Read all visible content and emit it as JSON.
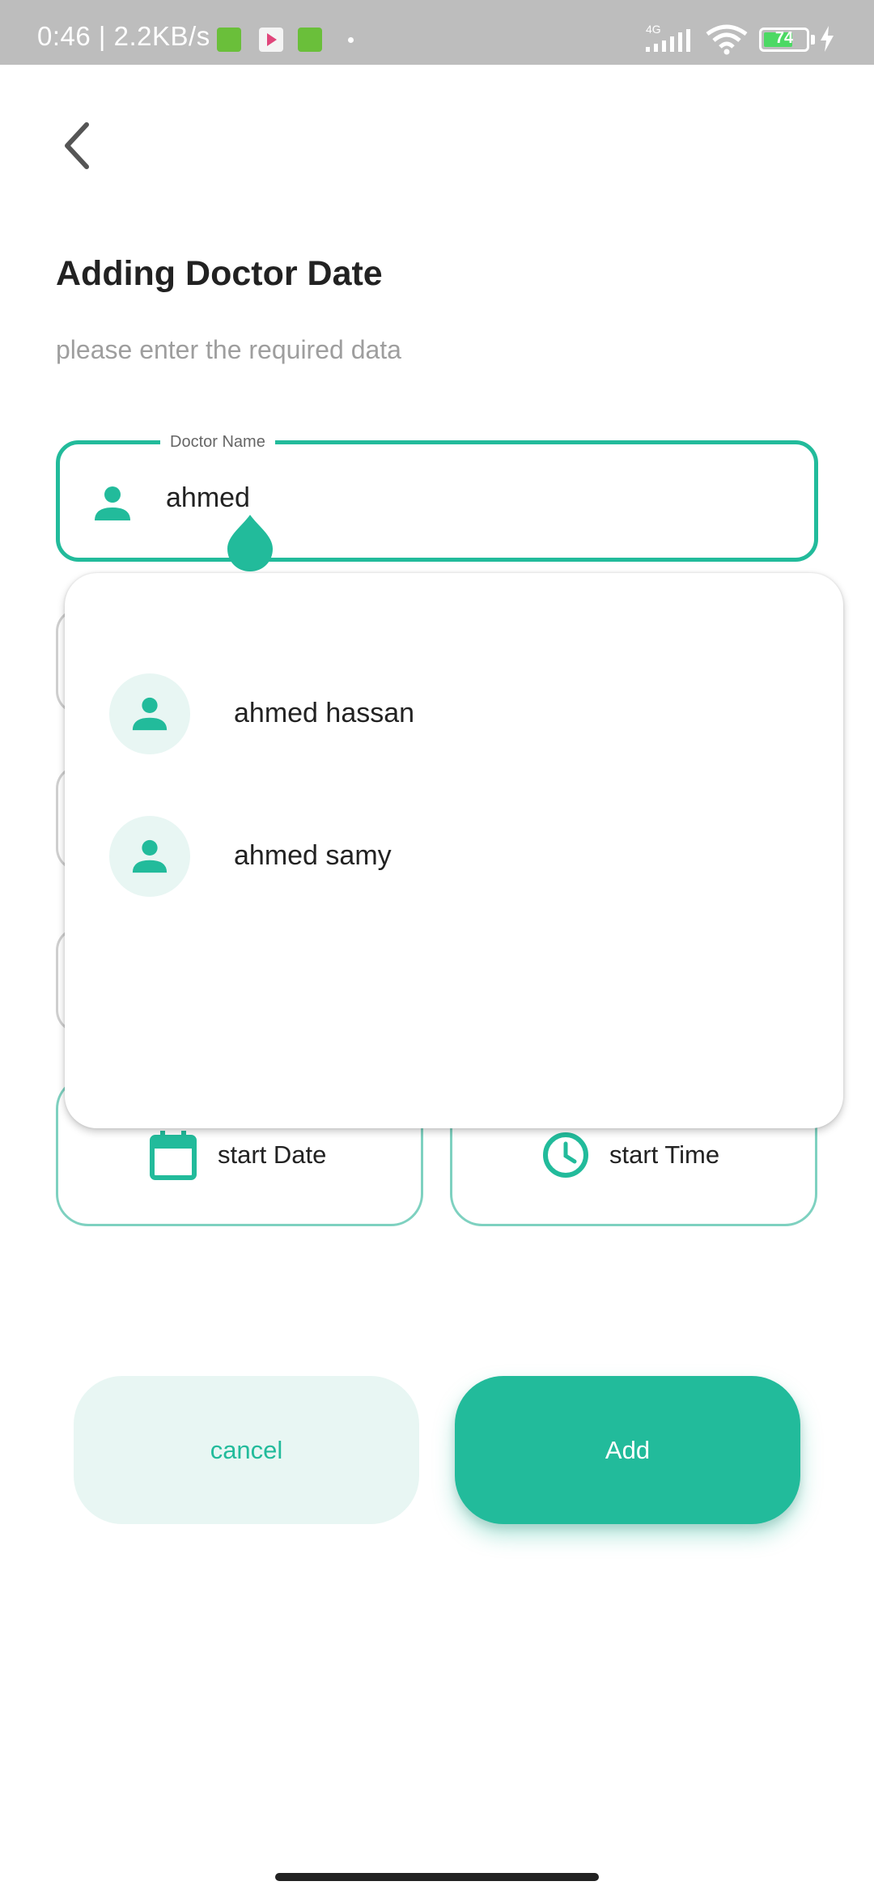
{
  "status_bar": {
    "time_speed": "0:46 | 2.2KB/s",
    "network": "4G",
    "battery": "74",
    "battery_level": 0.74
  },
  "header": {
    "title": "Adding Doctor Date",
    "subtitle": "please enter the required data"
  },
  "doctor_field": {
    "label": "Doctor Name",
    "value": "ahmed",
    "icon": "person-icon"
  },
  "suggestions": [
    {
      "name": "ahmed hassan",
      "icon": "person-icon"
    },
    {
      "name": "ahmed samy",
      "icon": "person-icon"
    }
  ],
  "schedule": {
    "date_label": "start Date",
    "date_icon": "calendar-icon",
    "time_label": "start Time",
    "time_icon": "clock-icon"
  },
  "actions": {
    "cancel_label": "cancel",
    "add_label": "Add"
  },
  "colors": {
    "accent": "#22bb9b",
    "accent_light": "#e8f6f3",
    "status_bar": "#bdbdbd"
  }
}
